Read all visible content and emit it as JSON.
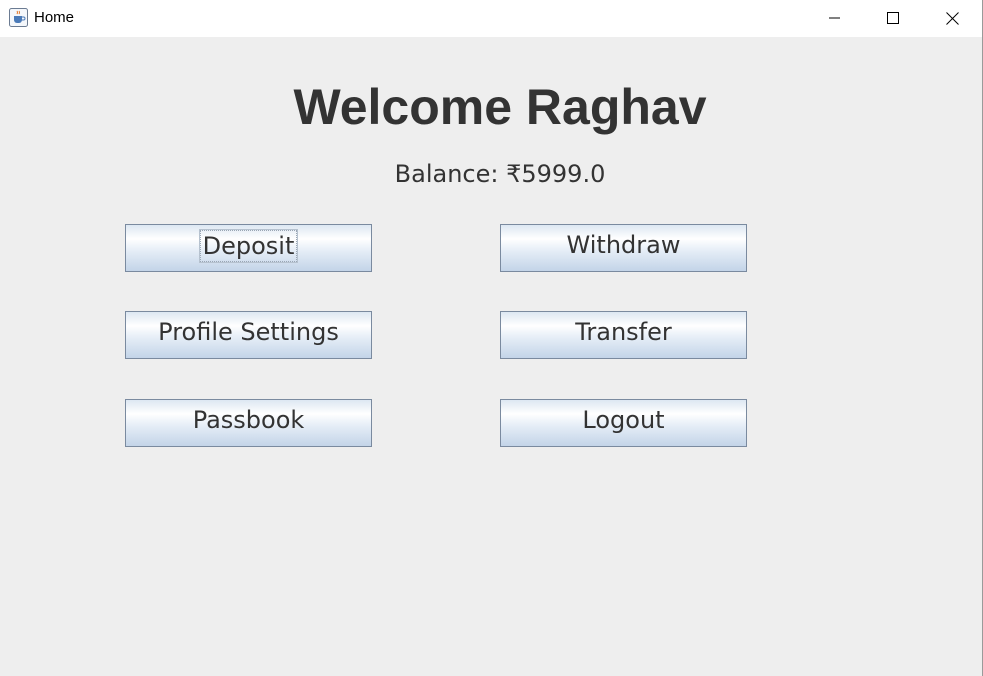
{
  "window": {
    "title": "Home",
    "app_icon": "java-cup-icon",
    "controls": [
      "minimize-icon",
      "maximize-icon",
      "close-icon"
    ]
  },
  "main": {
    "heading": "Welcome Raghav",
    "balance_label": "Balance: ₹5999.0",
    "buttons": {
      "deposit": "Deposit",
      "withdraw": "Withdraw",
      "profile_settings": "Profile Settings",
      "transfer": "Transfer",
      "passbook": "Passbook",
      "logout": "Logout"
    }
  },
  "colors": {
    "background": "#eeeeee",
    "text": "#333333",
    "button_border": "#7a8a9f",
    "button_gradient_bottom": "#c3d4e8"
  }
}
